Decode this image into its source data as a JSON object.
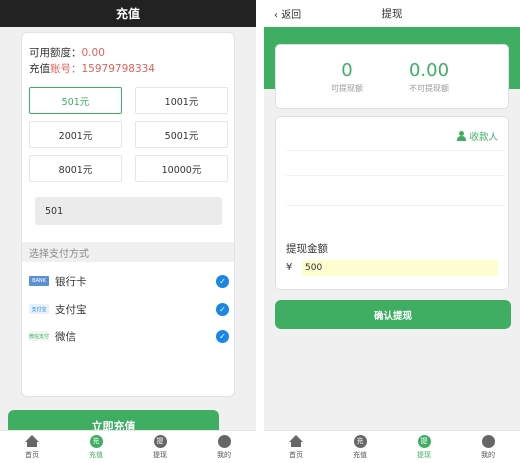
{
  "left": {
    "title": "充值",
    "available_label": "可用额度：",
    "available_value": "0.00",
    "account_label": "充值",
    "account_number_label": "账号：",
    "account_number": "15979798334",
    "amounts": [
      "501元",
      "1001元",
      "2001元",
      "5001元",
      "8001元",
      "10000元"
    ],
    "selected_amount_index": 0,
    "custom_amount": "501",
    "pay_section_title": "选择支付方式",
    "pay_methods": [
      {
        "label": "银行卡",
        "icon": "bank-card-icon",
        "icon_text": "BANK",
        "checked": true
      },
      {
        "label": "支付宝",
        "icon": "alipay-icon",
        "icon_text": "支付宝",
        "checked": true
      },
      {
        "label": "微信",
        "icon": "wechat-icon",
        "icon_text": "微信支付",
        "checked": true
      }
    ],
    "submit_label": "立即充值",
    "tabs": [
      {
        "label": "首页",
        "icon": "home-icon",
        "glyph": ""
      },
      {
        "label": "充值",
        "icon": "recharge-icon",
        "glyph": "充",
        "active": true
      },
      {
        "label": "提现",
        "icon": "withdraw-icon",
        "glyph": "提"
      },
      {
        "label": "我的",
        "icon": "user-icon",
        "glyph": ""
      }
    ]
  },
  "right": {
    "back_label": "返回",
    "title": "提现",
    "withdrawable_value": "0",
    "withdrawable_label": "可提现额",
    "non_withdrawable_value": "0.00",
    "non_withdrawable_label": "不可提现额",
    "payee_label": "收款人",
    "amount_label": "提现金额",
    "currency_symbol": "¥",
    "amount_value": "500",
    "confirm_label": "确认提现",
    "tabs": [
      {
        "label": "首页",
        "icon": "home-icon",
        "glyph": ""
      },
      {
        "label": "充值",
        "icon": "recharge-icon",
        "glyph": "充"
      },
      {
        "label": "提现",
        "icon": "withdraw-icon",
        "glyph": "提",
        "active": true
      },
      {
        "label": "我的",
        "icon": "user-icon",
        "glyph": ""
      }
    ]
  },
  "colors": {
    "accent": "#3fae63",
    "danger": "#e0615a",
    "check": "#1b86e6"
  }
}
